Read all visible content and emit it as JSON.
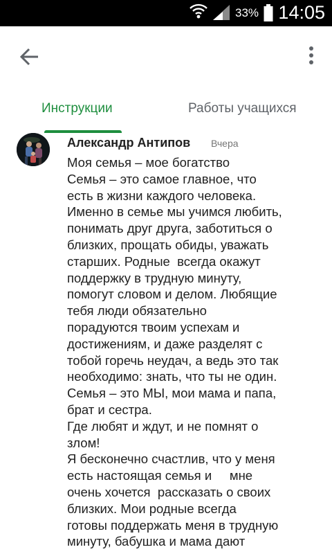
{
  "status_bar": {
    "battery_percent": "33%",
    "time": "14:05",
    "icons": [
      "wifi-icon",
      "signal-icon",
      "battery-icon"
    ]
  },
  "app_bar": {
    "back_icon": "arrow-left-icon",
    "menu_icon": "more-vert-icon"
  },
  "tabs": [
    {
      "label": "Инструкции",
      "active": true
    },
    {
      "label": "Работы учащихся",
      "active": false
    }
  ],
  "colors": {
    "accent": "#1e8e3e",
    "tab_inactive": "#5f6368",
    "text": "#212121",
    "secondary_text": "#757575"
  },
  "post": {
    "author": "Александр Антипов",
    "time": "Вчера",
    "lines": [
      "Моя семья – мое богатство",
      "Семья – это самое главное, что",
      "есть в жизни каждого человека.",
      "Именно в семье мы учимся любить,",
      "понимать друг друга, заботиться о",
      "близких, прощать обиды, уважать",
      "старших. Родные  всегда окажут",
      "поддержку в трудную минуту,",
      "помогут словом и делом. Любящие",
      "тебя люди обязательно",
      "порадуются твоим успехам и",
      "достижениям, и даже разделят с",
      "тобой горечь неудач, а ведь это так",
      "необходимо: знать, что ты не один.",
      "Семья – это МЫ, мои мама и папа,",
      "брат и сестра.",
      "Где любят и ждут, и не помнят о",
      "злом!",
      "Я бесконечно счастлив, что у меня",
      "есть настоящая семья и     мне",
      "очень хочется  рассказать о своих",
      "близких. Мои родные всегда",
      "готовы поддержать меня в трудную",
      "минуту, бабушка и мама дают"
    ]
  }
}
